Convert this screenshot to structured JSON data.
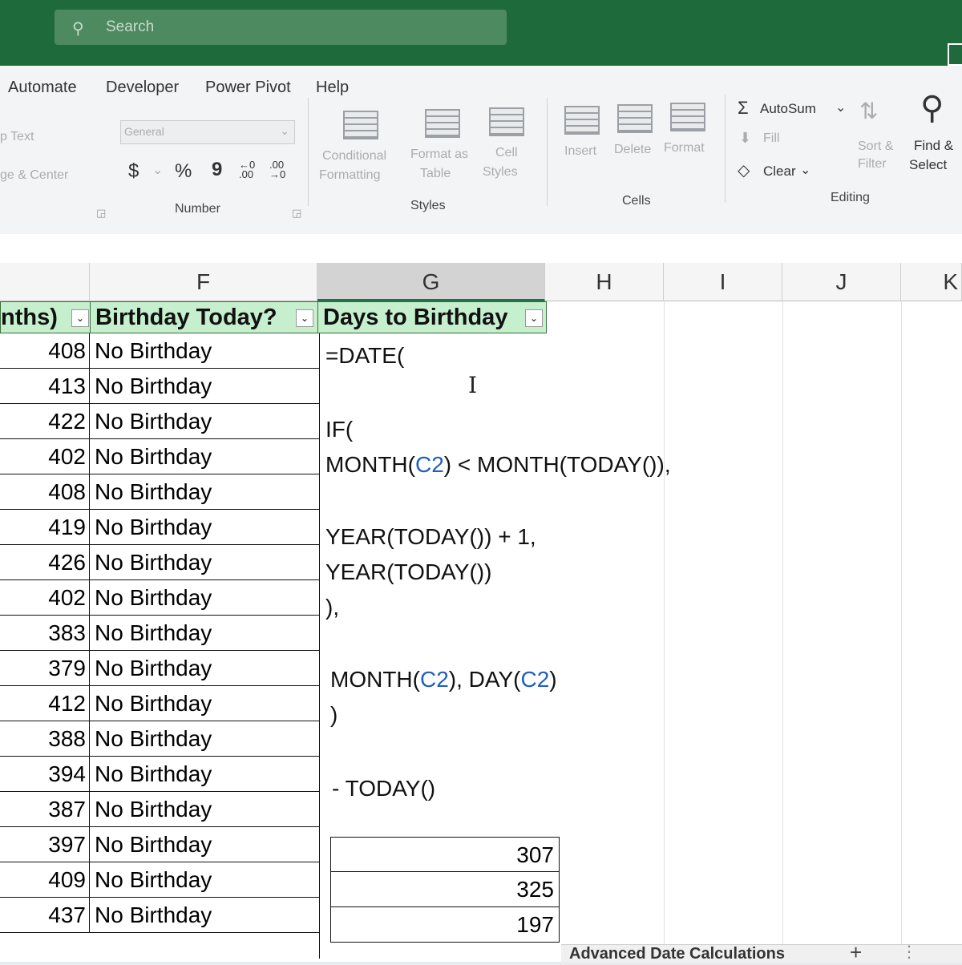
{
  "titlebar": {
    "search_placeholder": "Search",
    "search_icon": "search-icon"
  },
  "ribbon": {
    "tabs": [
      "Automate",
      "Developer",
      "Power Pivot",
      "Help"
    ],
    "alignment": {
      "wrap_text": "p Text",
      "merge_center": "ge & Center"
    },
    "number": {
      "format_value": "General",
      "currency": "$",
      "percent": "%",
      "comma": "9",
      "increase_decimal": "←0 .00",
      "decrease_decimal": ".00 →0",
      "group_label": "Number"
    },
    "styles": {
      "conditional_formatting": [
        "Conditional",
        "Formatting"
      ],
      "format_as_table": [
        "Format as",
        "Table"
      ],
      "cell_styles": [
        "Cell",
        "Styles"
      ],
      "group_label": "Styles"
    },
    "cells": {
      "insert": "Insert",
      "delete": "Delete",
      "format": "Format",
      "group_label": "Cells"
    },
    "editing": {
      "autosum": "AutoSum",
      "fill": "Fill",
      "clear": "Clear",
      "sort_filter": [
        "Sort &",
        "Filter"
      ],
      "find_select": [
        "Find &",
        "Select"
      ],
      "group_label": "Editing"
    }
  },
  "sheet": {
    "columns": [
      "F",
      "G",
      "H",
      "I",
      "J",
      "K"
    ],
    "headers": {
      "e": "nths)",
      "f": "Birthday Today?",
      "g": "Days to Birthday"
    },
    "rows": [
      {
        "e": "408",
        "f": "No Birthday"
      },
      {
        "e": "413",
        "f": "No Birthday"
      },
      {
        "e": "422",
        "f": "No Birthday"
      },
      {
        "e": "402",
        "f": "No Birthday"
      },
      {
        "e": "408",
        "f": "No Birthday"
      },
      {
        "e": "419",
        "f": "No Birthday"
      },
      {
        "e": "426",
        "f": "No Birthday"
      },
      {
        "e": "402",
        "f": "No Birthday"
      },
      {
        "e": "383",
        "f": "No Birthday"
      },
      {
        "e": "379",
        "f": "No Birthday"
      },
      {
        "e": "412",
        "f": "No Birthday"
      },
      {
        "e": "388",
        "f": "No Birthday"
      },
      {
        "e": "394",
        "f": "No Birthday"
      },
      {
        "e": "387",
        "f": "No Birthday"
      },
      {
        "e": "397",
        "f": "No Birthday"
      },
      {
        "e": "409",
        "f": "No Birthday"
      },
      {
        "e": "437",
        "f": "No Birthday"
      }
    ],
    "formula": {
      "line1": "=DATE(",
      "line2": "IF(",
      "line3a": "MONTH(",
      "ref1": "C2",
      "line3b": ") < MONTH(TODAY()),",
      "line4": "YEAR(TODAY()) + 1,",
      "line5": "YEAR(TODAY())",
      "line6": "),",
      "line7a": "MONTH(",
      "ref2": "C2",
      "line7b": "), DAY(",
      "ref3": "C2",
      "line7c": ")",
      "line8": ")",
      "line9": "- TODAY()"
    },
    "results": [
      "307",
      "325",
      "197"
    ],
    "sheet_tab": "Advanced Date Calculations",
    "add_sheet": "+",
    "sheet_menu": "⋮"
  }
}
